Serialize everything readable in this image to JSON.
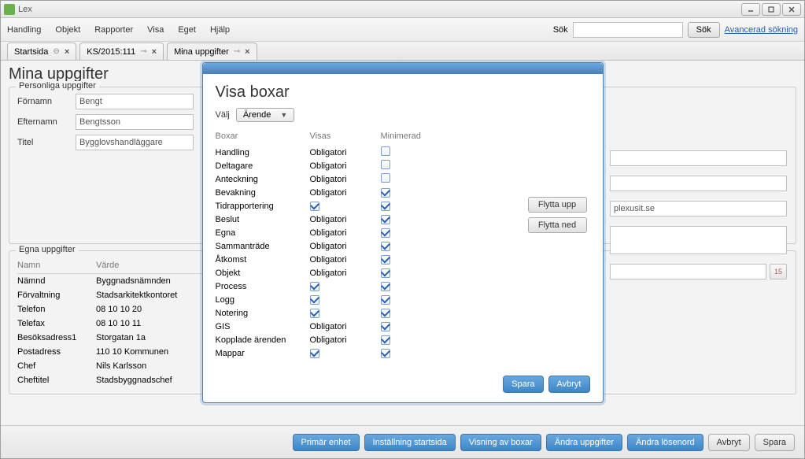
{
  "app": {
    "title": "Lex"
  },
  "menu": {
    "items": [
      "Handling",
      "Objekt",
      "Rapporter",
      "Visa",
      "Eget",
      "Hjälp"
    ],
    "search_label": "Sök",
    "search_btn": "Sök",
    "adv": "Avancerad sökning"
  },
  "tabs": [
    {
      "label": "Startsida"
    },
    {
      "label": "KS/2015:111"
    },
    {
      "label": "Mina uppgifter"
    }
  ],
  "page_title": "Mina uppgifter",
  "personliga": {
    "legend": "Personliga uppgifter",
    "fornamn_label": "Förnamn",
    "fornamn": "Bengt",
    "efternamn_label": "Efternamn",
    "efternamn": "Bengtsson",
    "titel_label": "Titel",
    "titel": "Bygglovshandläggare",
    "right_value": "plexusit.se",
    "cal_num": "15"
  },
  "egna": {
    "legend": "Egna uppgifter",
    "head": {
      "namn": "Namn",
      "varde": "Värde"
    },
    "rows": [
      {
        "n": "Nämnd",
        "v": "Byggnadsnämnden"
      },
      {
        "n": "Förvaltning",
        "v": "Stadsarkitektkontoret"
      },
      {
        "n": "Telefon",
        "v": "08 10 10 20"
      },
      {
        "n": "Telefax",
        "v": "08 10 10 11"
      },
      {
        "n": "Besöksadress1",
        "v": "Storgatan 1a"
      },
      {
        "n": "Postadress",
        "v": "110 10 Kommunen"
      },
      {
        "n": "Chef",
        "v": "Nils Karlsson"
      },
      {
        "n": "Cheftitel",
        "v": "Stadsbyggnadschef"
      }
    ]
  },
  "footer": {
    "primar": "Primär enhet",
    "installning": "Inställning startsida",
    "visning": "Visning av boxar",
    "andra_upp": "Ändra uppgifter",
    "andra_losen": "Ändra lösenord",
    "avbryt": "Avbryt",
    "spara": "Spara"
  },
  "dialog": {
    "title": "Visa boxar",
    "valj_label": "Välj",
    "valj_value": "Ärende",
    "head": {
      "boxar": "Boxar",
      "visas": "Visas",
      "min": "Minimerad"
    },
    "rows": [
      {
        "name": "Handling",
        "visas": "Obligatori",
        "min": false
      },
      {
        "name": "Deltagare",
        "visas": "Obligatori",
        "min": false
      },
      {
        "name": "Anteckning",
        "visas": "Obligatori",
        "min": false
      },
      {
        "name": "Bevakning",
        "visas": "Obligatori",
        "min": true
      },
      {
        "name": "Tidrapportering",
        "visas_chk": true,
        "min": true
      },
      {
        "name": "Beslut",
        "visas": "Obligatori",
        "min": true
      },
      {
        "name": "Egna",
        "visas": "Obligatori",
        "min": true
      },
      {
        "name": "Sammanträde",
        "visas": "Obligatori",
        "min": true
      },
      {
        "name": "Åtkomst",
        "visas": "Obligatori",
        "min": true
      },
      {
        "name": "Objekt",
        "visas": "Obligatori",
        "min": true
      },
      {
        "name": "Process",
        "visas_chk": true,
        "min": true
      },
      {
        "name": "Logg",
        "visas_chk": true,
        "min": true
      },
      {
        "name": "Notering",
        "visas_chk": true,
        "min": true
      },
      {
        "name": "GIS",
        "visas": "Obligatori",
        "min": true
      },
      {
        "name": "Kopplade ärenden",
        "visas": "Obligatori",
        "min": true
      },
      {
        "name": "Mappar",
        "visas_chk": true,
        "min": true
      }
    ],
    "flytta_upp": "Flytta upp",
    "flytta_ned": "Flytta ned",
    "spara": "Spara",
    "avbryt": "Avbryt"
  }
}
